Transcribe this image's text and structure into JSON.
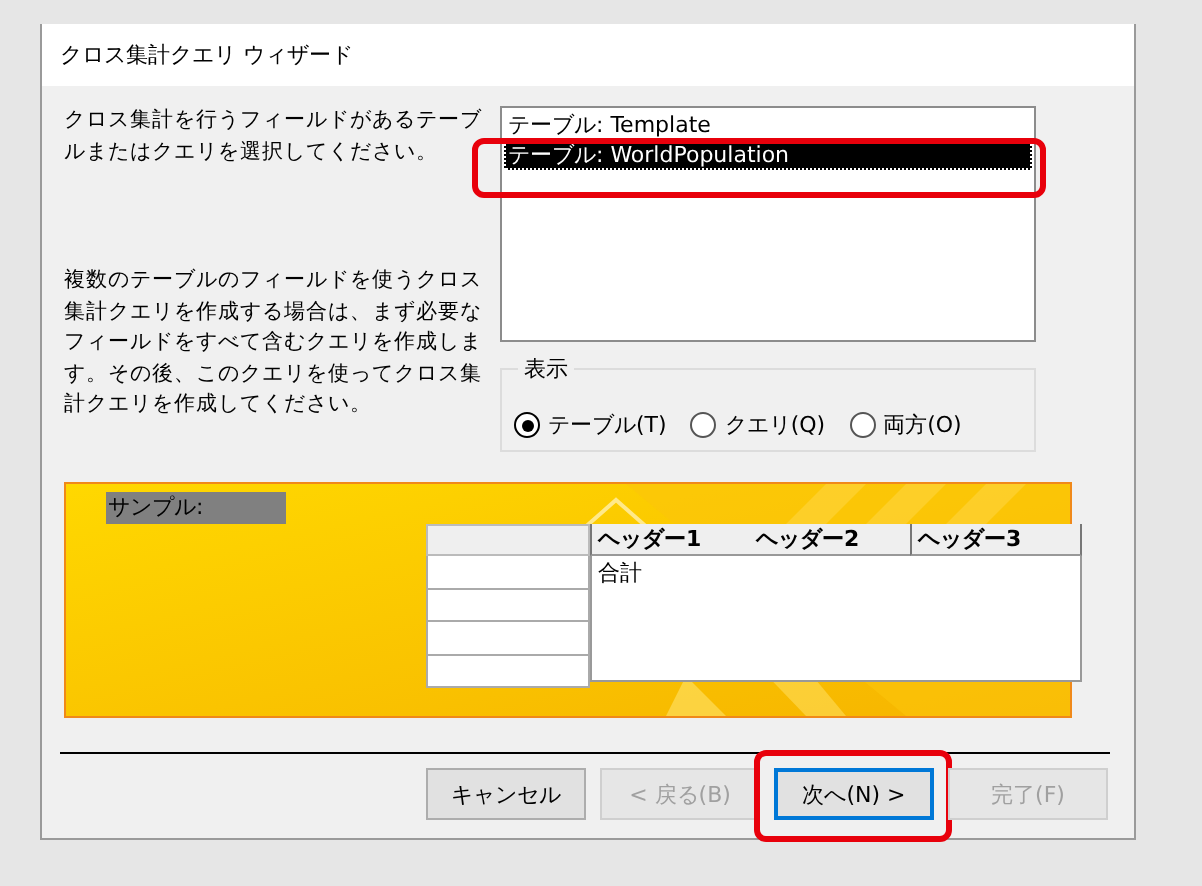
{
  "window": {
    "title": "クロス集計クエリ ウィザード"
  },
  "instructions": [
    {
      "text": "クロス集計を行うフィールドがあるテーブルまたはクエリを選択してください。"
    },
    {
      "text": "複数のテーブルのフィールドを使うクロス集計クエリを作成する場合は、まず必要なフィールドをすべて含むクエリを作成します。その後、このクエリを使ってクロス集計クエリを作成してください。"
    }
  ],
  "object_list": {
    "items": [
      {
        "label": "テーブル: Template",
        "selected": false,
        "highlighted": false
      },
      {
        "label": "テーブル: WorldPopulation",
        "selected": true,
        "highlighted": true
      }
    ]
  },
  "view_group": {
    "title": "表示",
    "options": [
      {
        "label": "テーブル(T)",
        "selected": true
      },
      {
        "label": "クエリ(Q)",
        "selected": false
      },
      {
        "label": "両方(O)",
        "selected": false
      }
    ]
  },
  "sample": {
    "label": "サンプル:",
    "headers": [
      "ヘッダー1",
      "ヘッダー2",
      "ヘッダー3"
    ],
    "cell": "合計"
  },
  "buttons": [
    {
      "label": "キャンセル",
      "disabled": false,
      "focused": false,
      "highlighted": false
    },
    {
      "label": "< 戻る(B)",
      "disabled": true,
      "focused": false,
      "highlighted": false
    },
    {
      "label": "次へ(N) >",
      "disabled": false,
      "focused": true,
      "highlighted": true
    },
    {
      "label": "完了(F)",
      "disabled": true,
      "focused": false,
      "highlighted": false
    }
  ]
}
